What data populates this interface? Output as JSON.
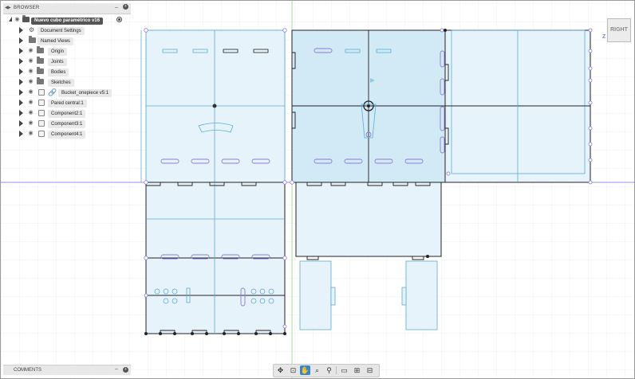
{
  "browser": {
    "title": "BROWSER",
    "root_document": "Nuevo cubo paramétrico v16",
    "items": [
      {
        "label": "Document Settings",
        "icon": "gear-icon"
      },
      {
        "label": "Named Views",
        "icon": "folder-icon"
      },
      {
        "label": "Origin",
        "icon": "folder-icon"
      },
      {
        "label": "Joints",
        "icon": "folder-icon"
      },
      {
        "label": "Bodies",
        "icon": "folder-icon"
      },
      {
        "label": "Sketches",
        "icon": "folder-icon"
      },
      {
        "label": "Bucket_onepiece v5:1",
        "icon": "link-icon"
      },
      {
        "label": "Pared central:1",
        "icon": "component-icon"
      },
      {
        "label": "Component2:1",
        "icon": "component-icon"
      },
      {
        "label": "Component3:1",
        "icon": "component-icon"
      },
      {
        "label": "Component4:1",
        "icon": "component-icon"
      }
    ]
  },
  "comments": {
    "title": "COMMENTS"
  },
  "viewcube": {
    "face": "RIGHT",
    "axis": "Z"
  },
  "toolbar": {
    "tools": [
      "orbit-icon",
      "look-at-icon",
      "pan-icon",
      "zoom-window-icon",
      "zoom-icon",
      "display-settings-icon",
      "grid-settings-icon",
      "viewports-icon"
    ],
    "active": "pan-icon"
  },
  "colors": {
    "sketch_blue": "#5aaed2",
    "profile_fill": "#e6f3fb",
    "selected_fill": "#d2e9f6",
    "constraint_purple": "#8c7ad6",
    "axis_green": "#58c458",
    "axis_purple": "#9a96e8",
    "grid": "#e6e6e6",
    "toolbar_active": "#2a8ad8"
  }
}
